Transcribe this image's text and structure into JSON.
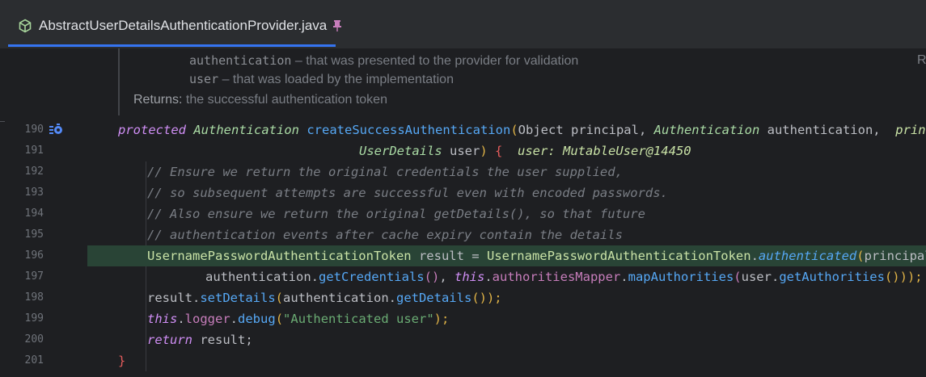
{
  "tab": {
    "filename": "AbstractUserDetailsAuthenticationProvider.java"
  },
  "doc": {
    "param1_name": "authentication",
    "param1_desc": " – that was presented to the provider for validation",
    "param2_name": "user",
    "param2_desc": " – that was loaded by the implementation",
    "returns_label": "Returns:",
    "returns_desc": "the successful authentication token",
    "right_edge_char": "R"
  },
  "line_numbers": [
    "190",
    "191",
    "192",
    "193",
    "194",
    "195",
    "196",
    "197",
    "198",
    "199",
    "200",
    "201"
  ],
  "code": {
    "l190": {
      "kw_protected": "protected",
      "type_auth": "Authentication",
      "method": "createSuccessAuthentication",
      "open": "(",
      "obj": "Object",
      "principal": " principal, ",
      "type_auth2": "Authentication",
      "authentication": " authentication,  ",
      "hint": "principa"
    },
    "l191": {
      "type_ud": "UserDetails",
      "user": " user",
      "close": ")",
      "brace": " {",
      "hint": "  user: MutableUser@14450"
    },
    "l192": "// Ensure we return the original credentials the user supplied,",
    "l193": "// so subsequent attempts are successful even with encoded passwords.",
    "l194": "// Also ensure we return the original getDetails(), so that future",
    "l195": "// authentication events after cache expiry contain the details",
    "l196": {
      "cls": "UsernamePasswordAuthenticationToken",
      "result": " result = ",
      "cls2": "UsernamePasswordAuthenticationToken",
      "dot": ".",
      "method": "authenticated",
      "open": "(",
      "principal": "principal,"
    },
    "l197": {
      "auth": "authentication.",
      "getCred": "getCredentials",
      "parens": "()",
      "comma": ", ",
      "this": "this",
      "dot1": ".",
      "field": "authoritiesMapper",
      "dot2": ".",
      "map": "mapAuthorities",
      "open": "(",
      "userdot": "user.",
      "getAuth": "getAuthorities",
      "close": "()));"
    },
    "l198": {
      "result": "result.",
      "setDetails": "setDetails",
      "open": "(",
      "auth": "authentication.",
      "getDetails": "getDetails",
      "close": "());"
    },
    "l199": {
      "this": "this",
      "dot": ".",
      "logger": "logger",
      "dot2": ".",
      "debug": "debug",
      "open": "(",
      "str": "\"Authenticated user\"",
      "close": ");"
    },
    "l200": {
      "ret": "return",
      "result": " result;"
    },
    "l201": "}"
  }
}
